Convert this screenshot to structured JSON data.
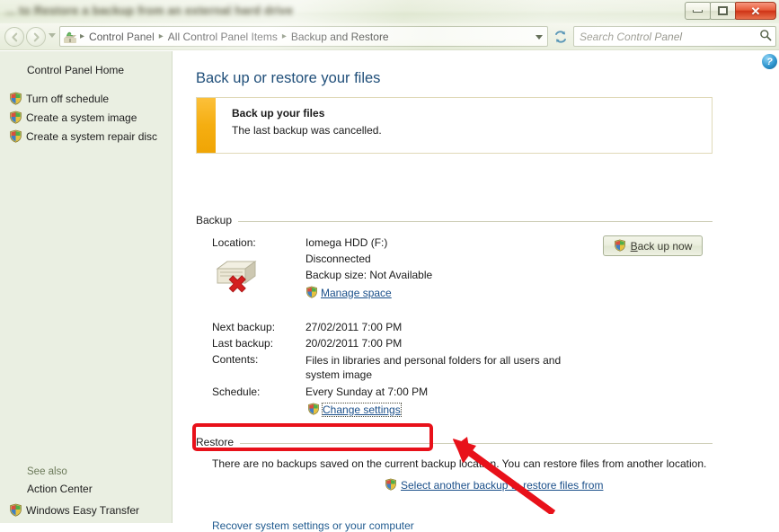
{
  "window": {
    "title": "... to Restore a backup from an external hard drive",
    "buttons": {
      "minimize": "Minimize",
      "maximize": "Maximize",
      "close": "✕"
    }
  },
  "navbar": {
    "back_icon": "◀",
    "forward_icon": "▶",
    "history_dropdown_icon": "chevron-down-icon",
    "address_icon": "control-panel-icon",
    "breadcrumbs": [
      "Control Panel",
      "All Control Panel Items",
      "Backup and Restore"
    ],
    "breadcrumb_separator": "▸",
    "refresh_icon": "↻",
    "search": {
      "placeholder": "Search Control Panel",
      "value": "",
      "icon": "search-icon"
    }
  },
  "sidebar": {
    "home_label": "Control Panel Home",
    "items": [
      {
        "label": "Turn off schedule",
        "icon": "shield-icon"
      },
      {
        "label": "Create a system image",
        "icon": "shield-icon"
      },
      {
        "label": "Create a system repair disc",
        "icon": "shield-icon"
      }
    ],
    "see_also_label": "See also",
    "see_also_items": [
      {
        "label": "Action Center",
        "icon": "none"
      },
      {
        "label": "Windows Easy Transfer",
        "icon": "shield-icon"
      }
    ]
  },
  "main": {
    "help_icon": "help-icon",
    "page_title": "Back up or restore your files",
    "alert": {
      "title": "Back up your files",
      "description": "The last backup was cancelled.",
      "accent_color": "#f5ae11"
    },
    "backup": {
      "group_label": "Backup",
      "location_label": "Location:",
      "location_value": "Iomega HDD (F:)",
      "location_status": "Disconnected",
      "backup_size": "Backup size: Not Available",
      "manage_space_link": "Manage space",
      "drive_icon": "external-drive-disconnected-icon",
      "backup_now_button": "Back up now",
      "backup_now_accel": "B",
      "rows": [
        {
          "label": "Next backup:",
          "value": "27/02/2011 7:00 PM"
        },
        {
          "label": "Last backup:",
          "value": "20/02/2011 7:00 PM"
        },
        {
          "label": "Contents:",
          "value": "Files in libraries and personal folders for all users and system image"
        },
        {
          "label": "Schedule:",
          "value": "Every Sunday at 7:00 PM"
        }
      ],
      "change_settings_link": "Change settings"
    },
    "restore": {
      "group_label": "Restore",
      "description": "There are no backups saved on the current backup location. You can restore files from another location.",
      "select_backup_link": "Select another backup to restore files from",
      "recover_link": "Recover system settings or your computer"
    }
  },
  "annotation": {
    "highlight_color": "#e8111a",
    "highlight_target": "select-another-backup-to-restore-files-from",
    "arrow_color": "#e8111a"
  }
}
